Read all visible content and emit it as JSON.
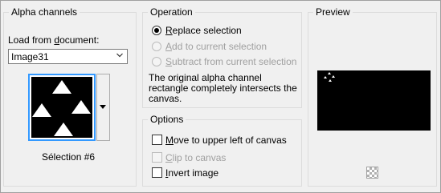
{
  "alpha": {
    "title": "Alpha channels",
    "load_label_pre": "Load from ",
    "load_label_u": "d",
    "load_label_post": "ocument:",
    "document_value": "Image31",
    "selection_label": "Sélection #6",
    "icons": {
      "dropdown": "chevron-down-icon",
      "thumb_dropdown": "caret-down-icon"
    }
  },
  "operation": {
    "title": "Operation",
    "options": [
      {
        "pre": "",
        "u": "R",
        "post": "eplace selection",
        "checked": true,
        "disabled": false
      },
      {
        "pre": "",
        "u": "A",
        "post": "dd to current selection",
        "checked": false,
        "disabled": true
      },
      {
        "pre": "",
        "u": "S",
        "post": "ubtract from current selection",
        "checked": false,
        "disabled": true
      }
    ],
    "info_text": "The original alpha channel rectangle completely intersects the canvas."
  },
  "options": {
    "title": "Options",
    "items": [
      {
        "pre": "",
        "u": "M",
        "post": "ove to upper left of canvas",
        "checked": false,
        "disabled": false
      },
      {
        "pre": "",
        "u": "C",
        "post": "lip to canvas",
        "checked": false,
        "disabled": true
      },
      {
        "pre": "",
        "u": "I",
        "post": "nvert image",
        "checked": false,
        "disabled": false
      }
    ]
  },
  "preview": {
    "title": "Preview",
    "icons": {
      "transparency": "checkerboard-icon"
    }
  }
}
